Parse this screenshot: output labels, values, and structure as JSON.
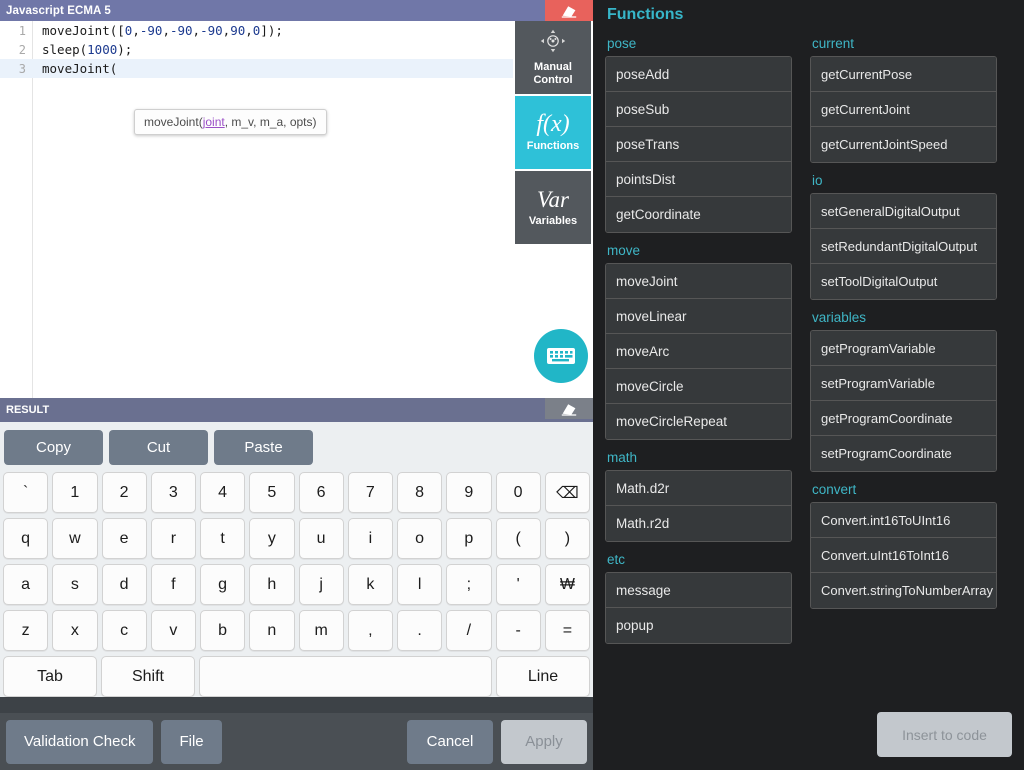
{
  "window": {
    "title": "Javascript ECMA 5",
    "eraser_icon": "eraser-icon"
  },
  "editor": {
    "lines": [
      {
        "num": "1",
        "text": "moveJoint([0,-90,-90,-90,90,0]);",
        "active": false
      },
      {
        "num": "2",
        "text": "sleep(1000);",
        "active": false
      },
      {
        "num": "3",
        "text": "moveJoint(",
        "active": true
      }
    ],
    "tooltip": {
      "prefix": "moveJoint(",
      "param": "joint",
      "suffix": ", m_v, m_a, opts)"
    }
  },
  "rail": {
    "buttons": [
      {
        "glyph": "✥",
        "label": "Manual\nControl",
        "label_l1": "Manual",
        "label_l2": "Control",
        "icon": "manual-control-icon",
        "active": false
      },
      {
        "glyph": "f(x)",
        "label_l1": "Functions",
        "label_l2": "",
        "icon": "functions-icon",
        "active": true
      },
      {
        "glyph": "Var",
        "label_l1": "Variables",
        "label_l2": "",
        "icon": "variables-icon",
        "active": false
      }
    ],
    "keyboard_fab_icon": "keyboard-icon"
  },
  "result": {
    "label": "RESULT",
    "eraser_icon": "eraser-icon"
  },
  "clipboard": {
    "copy": "Copy",
    "cut": "Cut",
    "paste": "Paste"
  },
  "keyboard": {
    "rows": [
      [
        "`",
        "1",
        "2",
        "3",
        "4",
        "5",
        "6",
        "7",
        "8",
        "9",
        "0",
        "⌫"
      ],
      [
        "q",
        "w",
        "e",
        "r",
        "t",
        "y",
        "u",
        "i",
        "o",
        "p",
        "(",
        ")"
      ],
      [
        "a",
        "s",
        "d",
        "f",
        "g",
        "h",
        "j",
        "k",
        "l",
        ";",
        "'",
        "₩"
      ],
      [
        "z",
        "x",
        "c",
        "v",
        "b",
        "n",
        "m",
        ",",
        ".",
        "/",
        "-",
        "="
      ]
    ],
    "bottom": {
      "tab": "Tab",
      "shift": "Shift",
      "space": "",
      "line": "Line"
    }
  },
  "footer": {
    "validation_check": "Validation Check",
    "file": "File",
    "cancel": "Cancel",
    "apply": "Apply"
  },
  "functions_panel": {
    "title": "Functions",
    "insert_button": "Insert to code",
    "left_column": [
      {
        "section": "pose",
        "items": [
          "poseAdd",
          "poseSub",
          "poseTrans",
          "pointsDist",
          "getCoordinate"
        ]
      },
      {
        "section": "move",
        "items": [
          "moveJoint",
          "moveLinear",
          "moveArc",
          "moveCircle",
          "moveCircleRepeat"
        ]
      },
      {
        "section": "math",
        "items": [
          "Math.d2r",
          "Math.r2d"
        ]
      },
      {
        "section": "etc",
        "items": [
          "message",
          "popup"
        ]
      }
    ],
    "right_column": [
      {
        "section": "current",
        "items": [
          "getCurrentPose",
          "getCurrentJoint",
          "getCurrentJointSpeed"
        ]
      },
      {
        "section": "io",
        "items": [
          "setGeneralDigitalOutput",
          "setRedundantDigitalOutput",
          "setToolDigitalOutput"
        ]
      },
      {
        "section": "variables",
        "items": [
          "getProgramVariable",
          "setProgramVariable",
          "getProgramCoordinate",
          "setProgramCoordinate"
        ]
      },
      {
        "section": "convert",
        "items": [
          "Convert.int16ToUInt16",
          "Convert.uInt16ToInt16",
          "Convert.stringToNumberArray"
        ]
      }
    ]
  },
  "colors": {
    "titlebar": "#7077a8",
    "eraser_red": "#e8625c",
    "accent_cyan": "#2ec1d8",
    "panel_bg": "#1e1f21",
    "section_header": "#3fb6c6",
    "button_grey": "#6f7b8a"
  }
}
